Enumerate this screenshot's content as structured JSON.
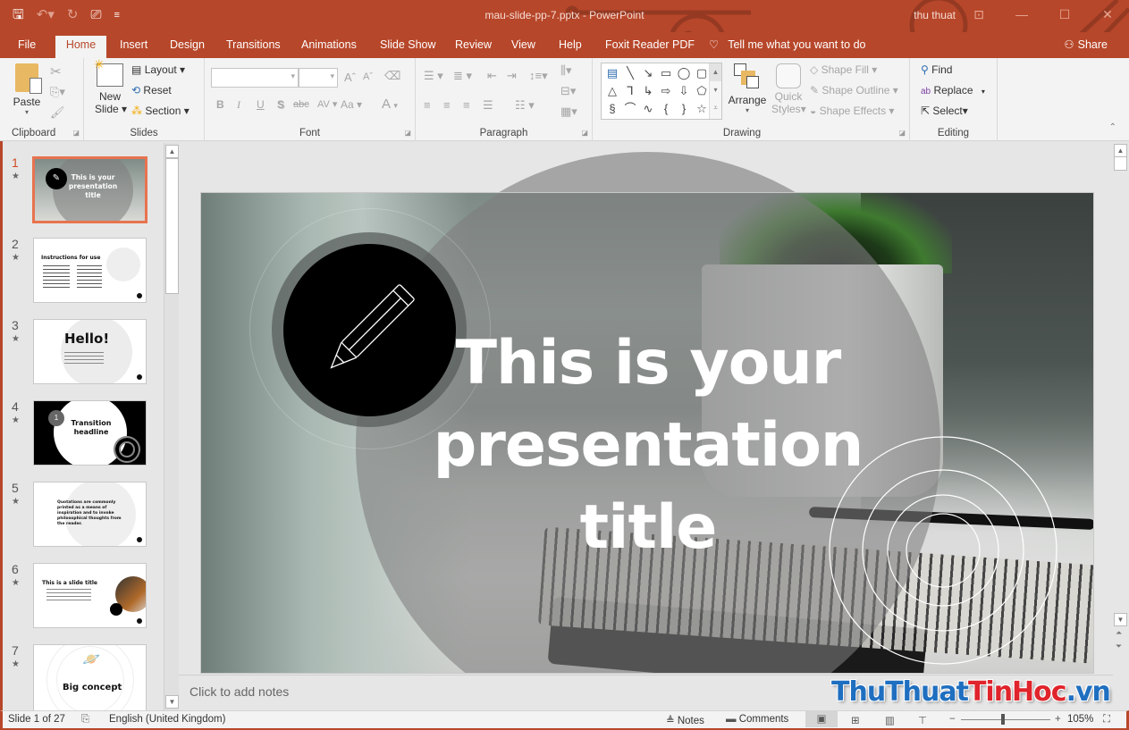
{
  "app": {
    "window_title": "mau-slide-pp-7.pptx  -  PowerPoint",
    "user_name": "thu thuat",
    "accent_color": "#b7472a"
  },
  "quick_access": {
    "save_icon": "save-icon",
    "undo_icon": "undo-icon",
    "redo_icon": "redo-icon",
    "present_icon": "start-presentation-icon",
    "customize_icon": "customize-qat-icon"
  },
  "tabs": [
    {
      "label": "File",
      "active": false
    },
    {
      "label": "Home",
      "active": true
    },
    {
      "label": "Insert",
      "active": false
    },
    {
      "label": "Design",
      "active": false
    },
    {
      "label": "Transitions",
      "active": false
    },
    {
      "label": "Animations",
      "active": false
    },
    {
      "label": "Slide Show",
      "active": false
    },
    {
      "label": "Review",
      "active": false
    },
    {
      "label": "View",
      "active": false
    },
    {
      "label": "Help",
      "active": false
    },
    {
      "label": "Foxit Reader PDF",
      "active": false
    }
  ],
  "tell_me": "Tell me what you want to do",
  "share": "Share",
  "ribbon": {
    "clipboard": {
      "label": "Clipboard",
      "paste": "Paste"
    },
    "slides": {
      "label": "Slides",
      "new_slide_1": "New",
      "new_slide_2": "Slide",
      "layout": "Layout",
      "reset": "Reset",
      "section": "Section"
    },
    "font": {
      "label": "Font",
      "font_name": "",
      "font_size": "",
      "bold": "B",
      "italic": "I",
      "underline": "U",
      "shadow": "S",
      "strike": "abc",
      "spacing": "AV",
      "case": "Aa",
      "color": "A"
    },
    "paragraph": {
      "label": "Paragraph"
    },
    "drawing": {
      "label": "Drawing",
      "arrange": "Arrange",
      "quick_styles_1": "Quick",
      "quick_styles_2": "Styles",
      "shape_fill": "Shape Fill",
      "shape_outline": "Shape Outline",
      "shape_effects": "Shape Effects"
    },
    "editing": {
      "label": "Editing",
      "find": "Find",
      "replace": "Replace",
      "select": "Select"
    }
  },
  "thumbnails": [
    {
      "number": "1",
      "title": "This is your presentation title",
      "selected": true
    },
    {
      "number": "2",
      "title": "Instructions for use",
      "selected": false
    },
    {
      "number": "3",
      "title": "Hello!",
      "selected": false
    },
    {
      "number": "4",
      "title": "Transition headline",
      "badge": "1",
      "selected": false
    },
    {
      "number": "5",
      "title": "Quotations are commonly printed as a means of inspiration and to invoke philosophical thoughts from the reader.",
      "selected": false
    },
    {
      "number": "6",
      "title": "This is a slide title",
      "selected": false
    },
    {
      "number": "7",
      "title": "Big concept",
      "selected": false
    }
  ],
  "slide": {
    "title_line1": "This is your",
    "title_line2": "presentation",
    "title_line3": "title"
  },
  "notes_placeholder": "Click to add notes",
  "status": {
    "slide_counter": "Slide 1 of 27",
    "language": "English (United Kingdom)",
    "notes": "Notes",
    "comments": "Comments",
    "zoom_percent": "105%",
    "zoom_value": 105
  },
  "watermark": {
    "part1": "ThuThuat",
    "part2": "TinHoc",
    "part3": ".vn"
  }
}
